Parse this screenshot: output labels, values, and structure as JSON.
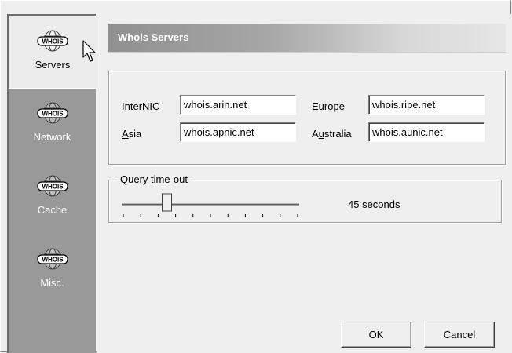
{
  "sidebar": {
    "items": [
      {
        "label": "Servers",
        "icon": "whois-globe-icon",
        "badge": "WHOIS",
        "selected": true
      },
      {
        "label": "Network",
        "icon": "whois-globe-icon",
        "badge": "WHOIS",
        "selected": false
      },
      {
        "label": "Cache",
        "icon": "whois-globe-icon",
        "badge": "WHOIS",
        "selected": false
      },
      {
        "label": "Misc.",
        "icon": "whois-globe-icon",
        "badge": "WHOIS",
        "selected": false
      }
    ]
  },
  "header": {
    "title": "Whois Servers"
  },
  "servers": {
    "internic": {
      "label_mnemonic": "I",
      "label_rest": "nterNIC",
      "value": "whois.arin.net"
    },
    "europe": {
      "label_mnemonic": "E",
      "label_rest": "urope",
      "value": "whois.ripe.net"
    },
    "asia": {
      "label_mnemonic": "A",
      "label_rest": "sia",
      "value": "whois.apnic.net"
    },
    "australia": {
      "label_pre": "A",
      "label_mnemonic": "u",
      "label_rest": "stralia",
      "value": "whois.aunic.net"
    }
  },
  "timeout": {
    "legend": "Query time-out",
    "value_text": "45 seconds",
    "slider_level": 0.25,
    "tick_count": 11
  },
  "buttons": {
    "ok": "OK",
    "cancel": "Cancel"
  },
  "colors": {
    "sidebar": "#999999",
    "banner_start": "#909090",
    "banner_end": "#e6e6e6"
  }
}
